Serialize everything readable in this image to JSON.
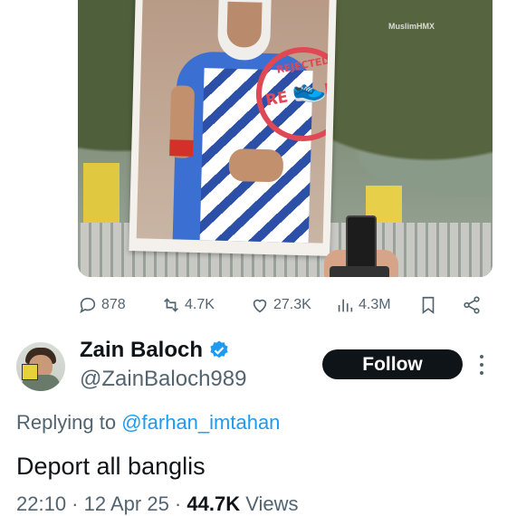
{
  "media": {
    "watermark": "MuslimHMX"
  },
  "actions": {
    "replies": "878",
    "reposts": "4.7K",
    "likes": "27.3K",
    "views": "4.3M"
  },
  "reply": {
    "name": "Zain Baloch",
    "handle": "@ZainBaloch989",
    "follow_label": "Follow",
    "replying_prefix": "Replying to",
    "replying_to": "@farhan_imtahan",
    "text": "Deport all banglis",
    "time": "22:10",
    "date": "12 Apr 25",
    "views_count": "44.7K",
    "views_label": "Views"
  },
  "colors": {
    "accent": "#1d9bf0",
    "muted": "#536471",
    "follow_bg": "#0f1419"
  }
}
